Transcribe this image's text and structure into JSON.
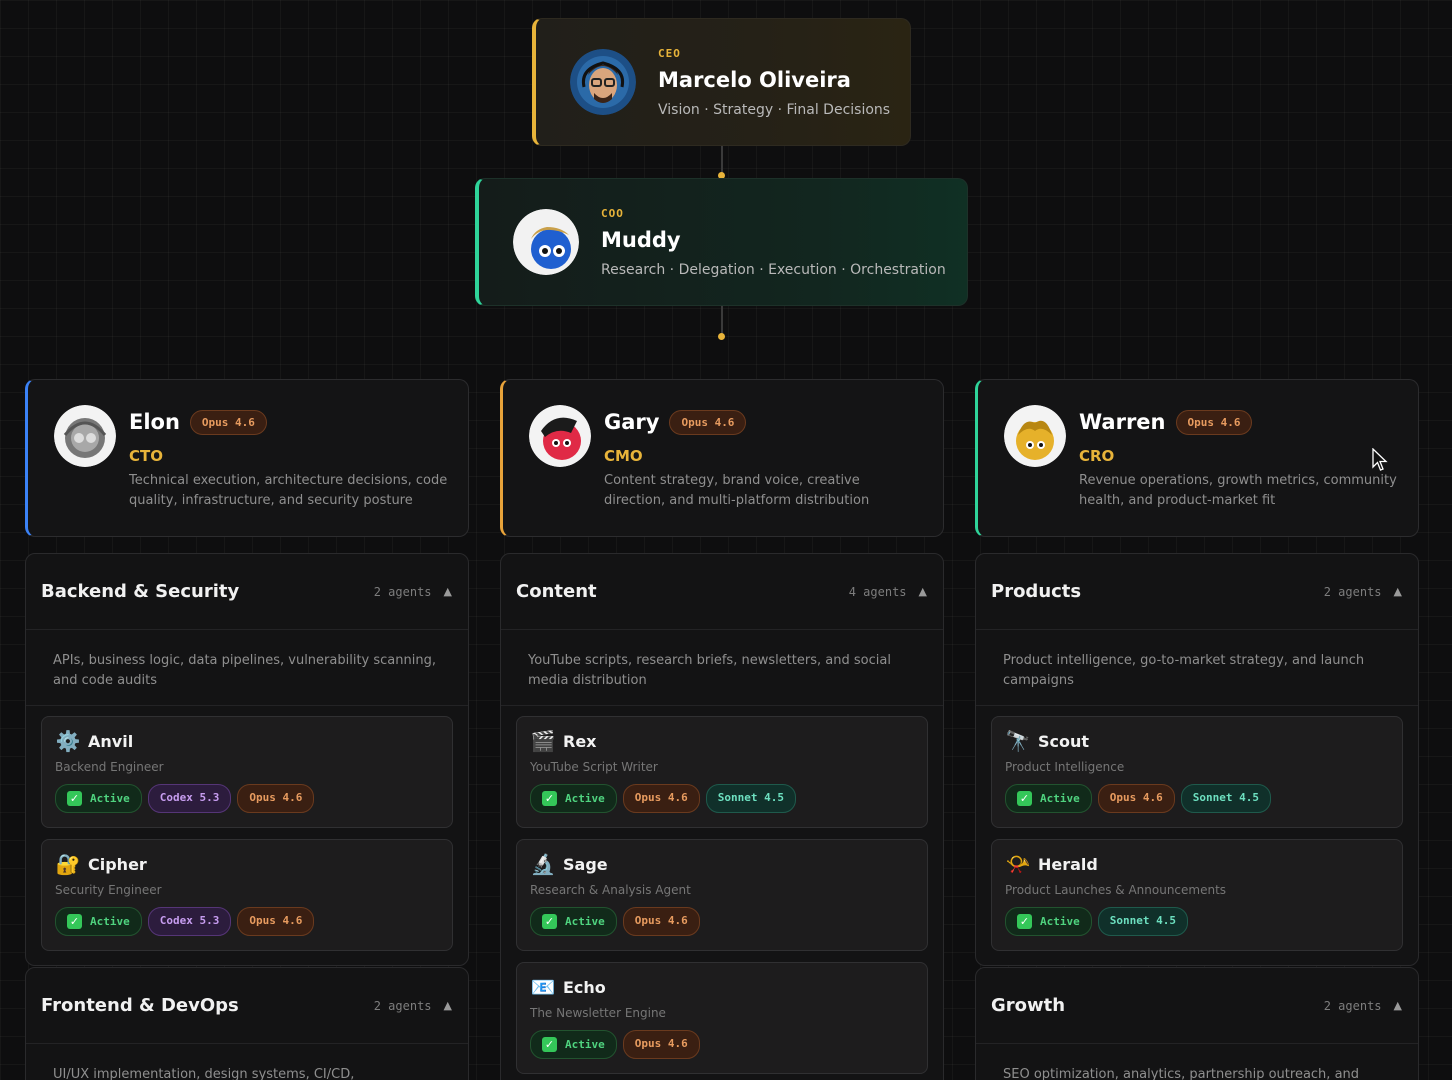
{
  "ceo": {
    "role": "CEO",
    "name": "Marcelo Oliveira",
    "desc": "Vision · Strategy · Final Decisions"
  },
  "coo": {
    "role": "COO",
    "name": "Muddy",
    "desc": "Research · Delegation · Execution · Orchestration"
  },
  "heads": [
    {
      "name": "Elon",
      "model": "Opus 4.6",
      "title": "CTO",
      "desc": "Technical execution, architecture decisions, code quality, infrastructure, and security posture",
      "accent": "#3b82f6"
    },
    {
      "name": "Gary",
      "model": "Opus 4.6",
      "title": "CMO",
      "desc": "Content strategy, brand voice, creative direction, and multi-platform distribution",
      "accent": "#e8a33a"
    },
    {
      "name": "Warren",
      "model": "Opus 4.6",
      "title": "CRO",
      "desc": "Revenue operations, growth metrics, community health, and product-market fit",
      "accent": "#2fd49a"
    }
  ],
  "departments": [
    {
      "name": "Backend & Security",
      "count": "2 agents",
      "desc": "APIs, business logic, data pipelines, vulnerability scanning, and code audits",
      "agents": [
        {
          "icon": "gear-icon",
          "glyph": "⚙️",
          "name": "Anvil",
          "role": "Backend Engineer",
          "status": "Active",
          "models": [
            "Codex 5.3",
            "Opus 4.6"
          ]
        },
        {
          "icon": "lock-icon",
          "glyph": "🔐",
          "name": "Cipher",
          "role": "Security Engineer",
          "status": "Active",
          "models": [
            "Codex 5.3",
            "Opus 4.6"
          ]
        }
      ]
    },
    {
      "name": "Content",
      "count": "4 agents",
      "desc": "YouTube scripts, research briefs, newsletters, and social media distribution",
      "agents": [
        {
          "icon": "clapper-icon",
          "glyph": "🎬",
          "name": "Rex",
          "role": "YouTube Script Writer",
          "status": "Active",
          "models": [
            "Opus 4.6",
            "Sonnet 4.5"
          ]
        },
        {
          "icon": "microscope-icon",
          "glyph": "🔬",
          "name": "Sage",
          "role": "Research & Analysis Agent",
          "status": "Active",
          "models": [
            "Opus 4.6"
          ]
        },
        {
          "icon": "newsletter-icon",
          "glyph": "📧",
          "name": "Echo",
          "role": "The Newsletter Engine",
          "status": "Active",
          "models": [
            "Opus 4.6"
          ]
        }
      ]
    },
    {
      "name": "Products",
      "count": "2 agents",
      "desc": "Product intelligence, go-to-market strategy, and launch campaigns",
      "agents": [
        {
          "icon": "telescope-icon",
          "glyph": "🔭",
          "name": "Scout",
          "role": "Product Intelligence",
          "status": "Active",
          "models": [
            "Opus 4.6",
            "Sonnet 4.5"
          ]
        },
        {
          "icon": "horn-icon",
          "glyph": "📯",
          "name": "Herald",
          "role": "Product Launches & Announcements",
          "status": "Active",
          "models": [
            "Sonnet 4.5"
          ]
        }
      ]
    }
  ],
  "departments_lower": [
    {
      "name": "Frontend & DevOps",
      "count": "2 agents",
      "desc": "UI/UX implementation, design systems, CI/CD,"
    },
    {
      "name": "Growth",
      "count": "2 agents",
      "desc": "SEO optimization, analytics, partnership outreach, and"
    }
  ]
}
